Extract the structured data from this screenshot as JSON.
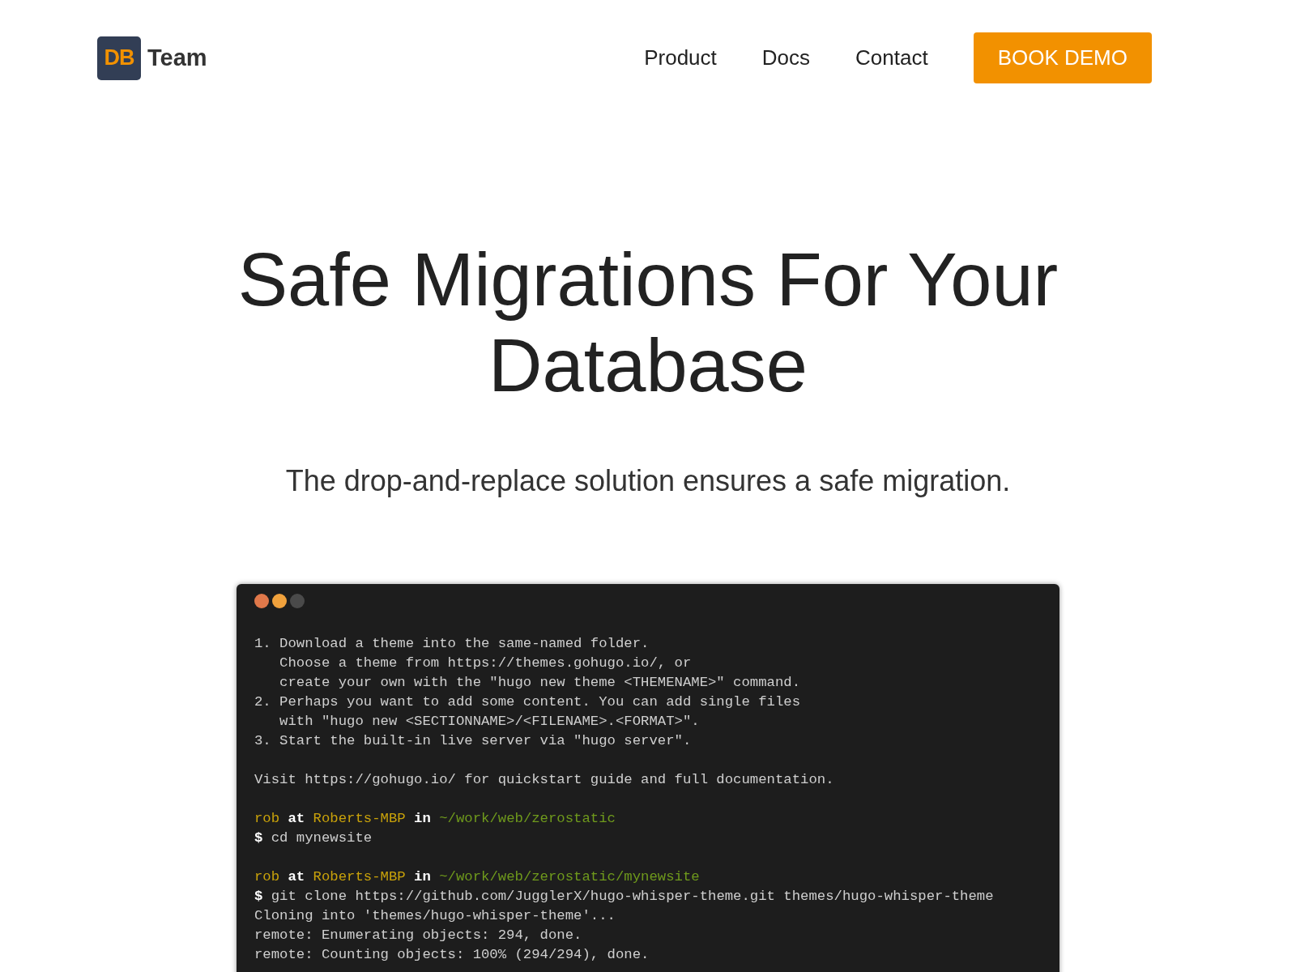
{
  "brand": {
    "mark": "DB",
    "name": "Team"
  },
  "nav": {
    "links": [
      "Product",
      "Docs",
      "Contact"
    ],
    "cta": "BOOK DEMO"
  },
  "hero": {
    "title": "Safe Migrations For Your Database",
    "subtitle": "The drop-and-replace solution ensures a safe migration."
  },
  "terminal": {
    "dots": [
      {
        "color": "#e0784a"
      },
      {
        "color": "#f0a13c"
      },
      {
        "color": "#4a4a4a"
      }
    ],
    "blocks": [
      [
        [
          {
            "kind": "plain",
            "text": "1. Download a theme into the same-named folder."
          }
        ],
        [
          {
            "kind": "plain",
            "text": "   Choose a theme from https://themes.gohugo.io/, or"
          }
        ],
        [
          {
            "kind": "plain",
            "text": "   create your own with the \"hugo new theme <THEMENAME>\" command."
          }
        ],
        [
          {
            "kind": "plain",
            "text": "2. Perhaps you want to add some content. You can add single files"
          }
        ],
        [
          {
            "kind": "plain",
            "text": "   with \"hugo new <SECTIONNAME>/<FILENAME>.<FORMAT>\"."
          }
        ],
        [
          {
            "kind": "plain",
            "text": "3. Start the built-in live server via \"hugo server\"."
          }
        ]
      ],
      [
        [
          {
            "kind": "plain",
            "text": "Visit https://gohugo.io/ for quickstart guide and full documentation."
          }
        ]
      ],
      [
        [
          {
            "kind": "user",
            "text": "rob"
          },
          {
            "kind": "word",
            "text": " at "
          },
          {
            "kind": "host",
            "text": "Roberts-MBP"
          },
          {
            "kind": "word",
            "text": " in "
          },
          {
            "kind": "path",
            "text": "~/work/web/zerostatic"
          }
        ],
        [
          {
            "kind": "prompt",
            "text": "$"
          },
          {
            "kind": "plain",
            "text": " cd mynewsite"
          }
        ]
      ],
      [
        [
          {
            "kind": "user",
            "text": "rob"
          },
          {
            "kind": "word",
            "text": " at "
          },
          {
            "kind": "host",
            "text": "Roberts-MBP"
          },
          {
            "kind": "word",
            "text": " in "
          },
          {
            "kind": "path",
            "text": "~/work/web/zerostatic/mynewsite"
          }
        ],
        [
          {
            "kind": "prompt",
            "text": "$"
          },
          {
            "kind": "plain",
            "text": " git clone https://github.com/JugglerX/hugo-whisper-theme.git themes/hugo-whisper-theme"
          }
        ],
        [
          {
            "kind": "plain",
            "text": "Cloning into 'themes/hugo-whisper-theme'..."
          }
        ],
        [
          {
            "kind": "plain",
            "text": "remote: Enumerating objects: 294, done."
          }
        ],
        [
          {
            "kind": "plain",
            "text": "remote: Counting objects: 100% (294/294), done."
          }
        ]
      ]
    ]
  }
}
